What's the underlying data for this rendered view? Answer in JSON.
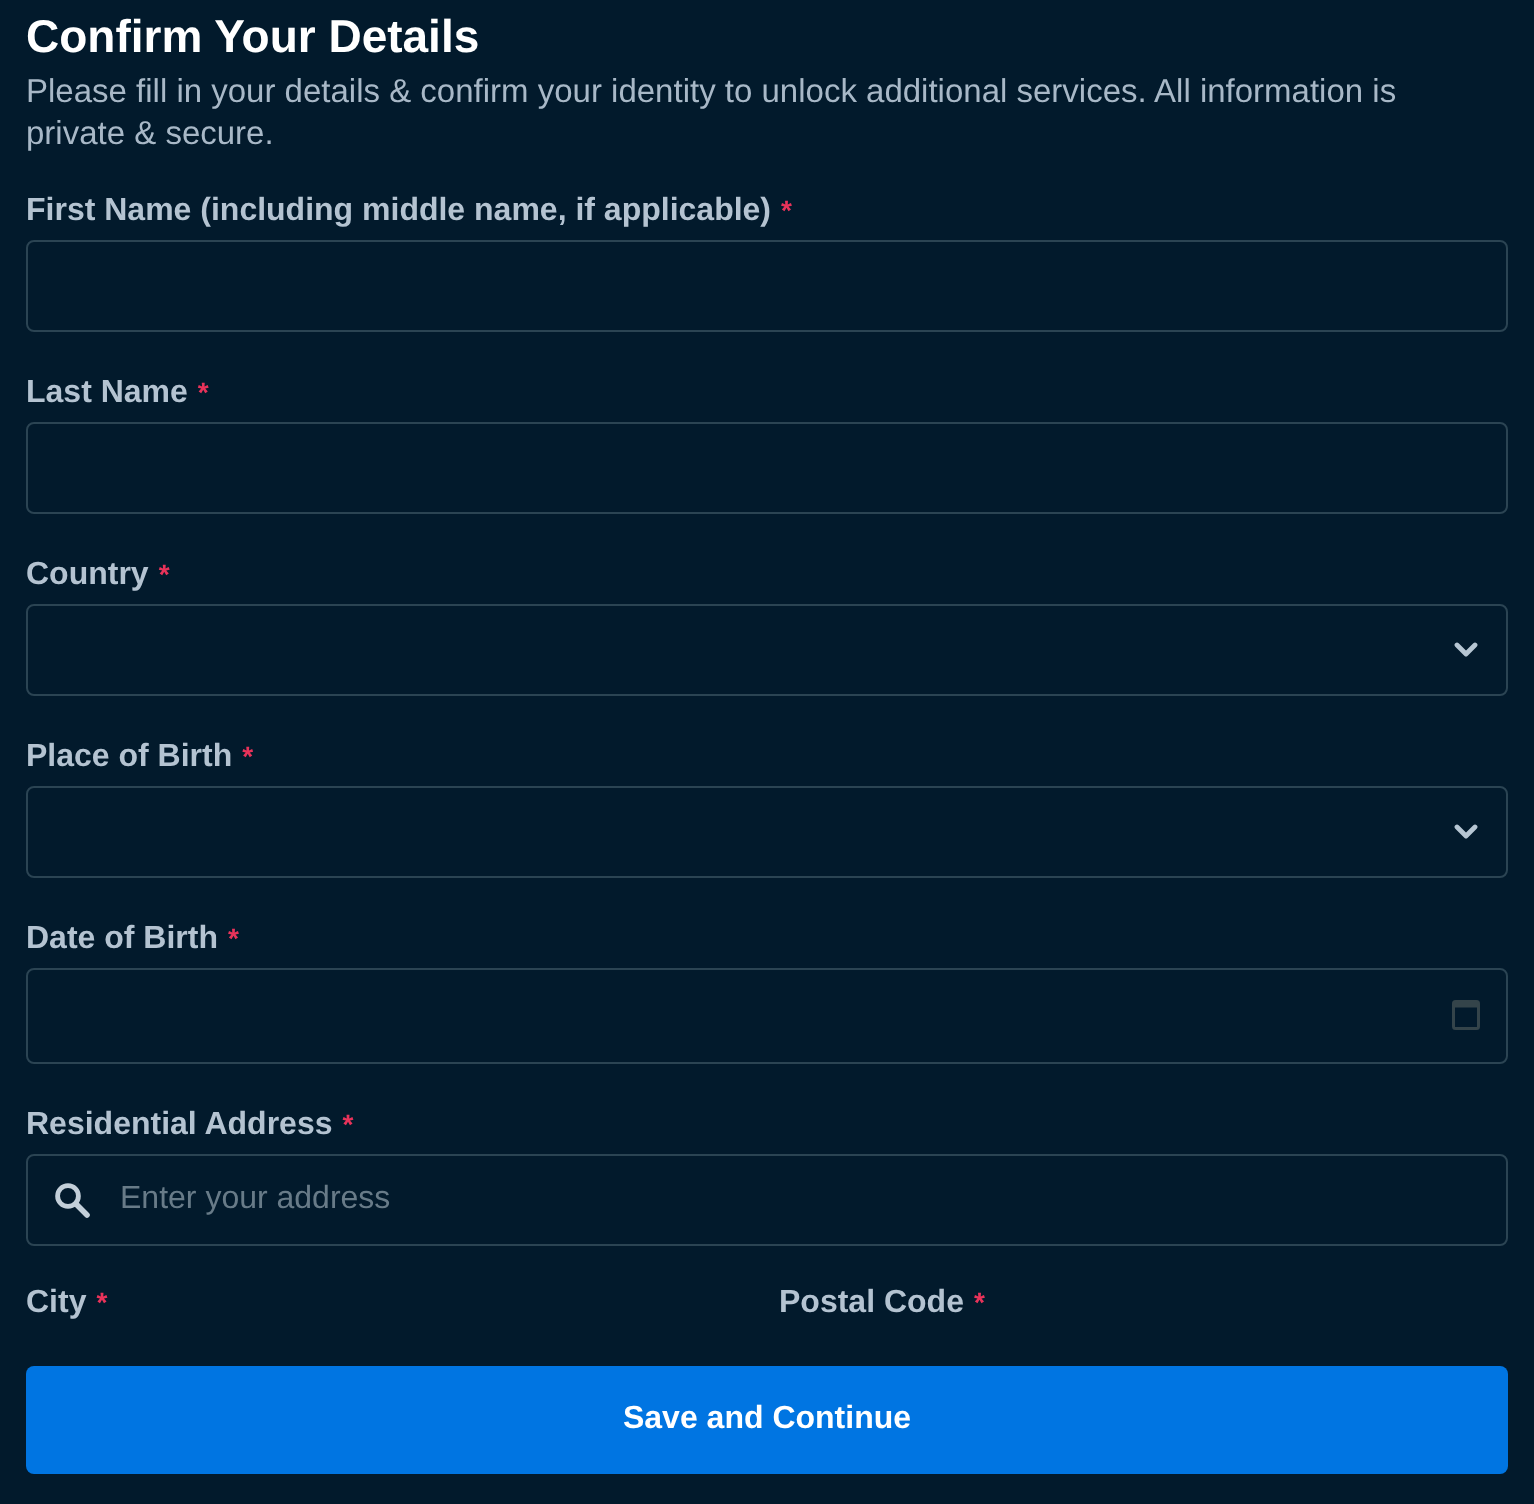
{
  "title": "Confirm Your Details",
  "description": "Please fill in your details & confirm your identity to unlock additional services. All information is private & secure.",
  "fields": [
    {
      "kind": "text",
      "label": "First Name (including middle name, if applicable)",
      "marker": "*"
    },
    {
      "kind": "text",
      "label": "Last Name",
      "marker": "*"
    },
    {
      "kind": "select",
      "label": "Country",
      "marker": "*"
    },
    {
      "kind": "select",
      "label": "Place of Birth",
      "marker": "*"
    },
    {
      "kind": "date",
      "label": "Date of Birth",
      "marker": "*"
    },
    {
      "kind": "search",
      "label": "Residential Address",
      "marker": "*",
      "placeholder": "Enter your address"
    }
  ],
  "split_labels": [
    {
      "label": "City",
      "marker": "*"
    },
    {
      "label": "Postal Code",
      "marker": "*"
    }
  ],
  "button": {
    "label": "Save and Continue"
  }
}
